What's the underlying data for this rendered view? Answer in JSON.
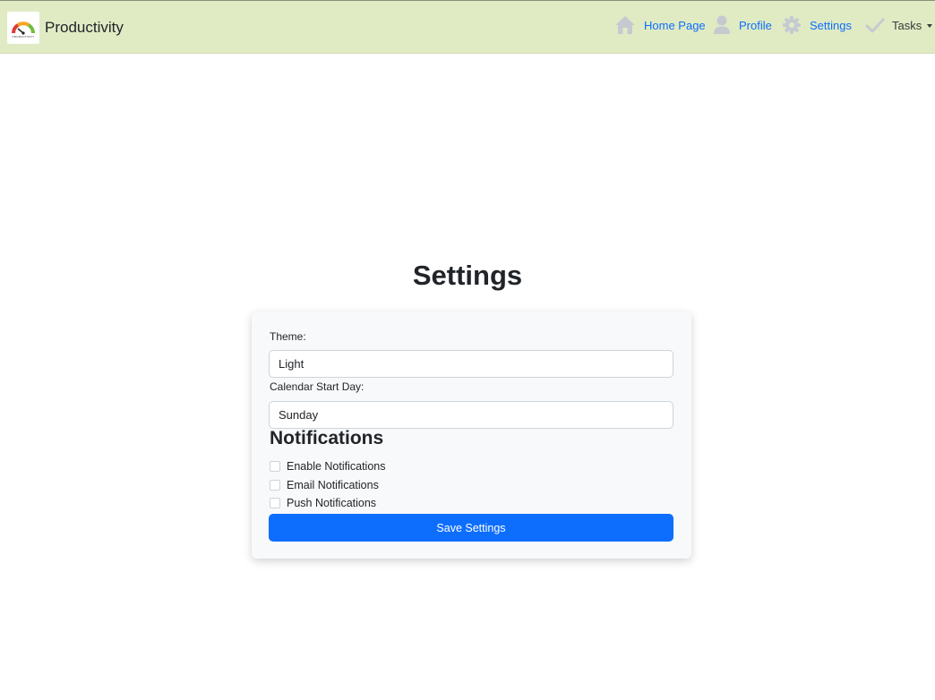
{
  "navbar": {
    "brand": "Productivity",
    "logo_text": "PRODUCTIVITY",
    "links": [
      {
        "label": "Home Page",
        "icon": "home-icon"
      },
      {
        "label": "Profile",
        "icon": "user-icon"
      },
      {
        "label": "Settings",
        "icon": "gear-icon"
      },
      {
        "label": "Tasks",
        "icon": "check-icon"
      }
    ]
  },
  "page": {
    "title": "Settings"
  },
  "form": {
    "theme_label": "Theme:",
    "theme_value": "Light",
    "calendar_label": "Calendar Start Day:",
    "calendar_value": "Sunday",
    "notifications_title": "Notifications",
    "checkboxes": [
      {
        "label": "Enable Notifications",
        "checked": false
      },
      {
        "label": "Email Notifications",
        "checked": false
      },
      {
        "label": "Push Notifications",
        "checked": false
      }
    ],
    "save_label": "Save Settings"
  },
  "colors": {
    "navbar_bg": "#e0ebc4",
    "link": "#0d6efd",
    "button_bg": "#0d6efd",
    "icon_gray": "#c5cad1"
  }
}
